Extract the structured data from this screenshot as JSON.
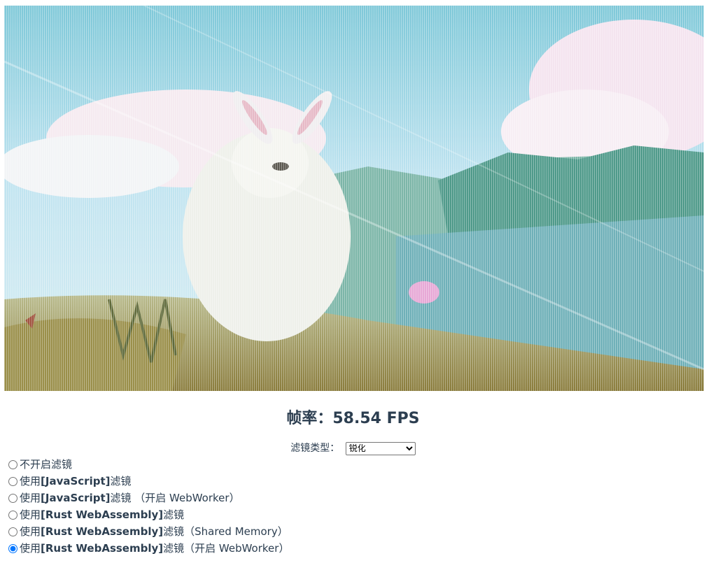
{
  "fps": {
    "label": "帧率：",
    "value": "58.54",
    "unit": "FPS"
  },
  "filter": {
    "label": "滤镜类型：",
    "selected": "锐化",
    "options": [
      "锐化"
    ]
  },
  "modes": [
    {
      "prefix": "不开启滤镜",
      "tech": "",
      "suffix": "",
      "checked": false
    },
    {
      "prefix": "使用 ",
      "tech": "[JavaScript]",
      "suffix": " 滤镜",
      "checked": false
    },
    {
      "prefix": "使用 ",
      "tech": "[JavaScript]",
      "suffix": " 滤镜 （开启 WebWorker）",
      "checked": false
    },
    {
      "prefix": "使用 ",
      "tech": "[Rust WebAssembly]",
      "suffix": " 滤镜",
      "checked": false
    },
    {
      "prefix": "使用 ",
      "tech": "[Rust WebAssembly]",
      "suffix": " 滤镜（Shared Memory）",
      "checked": false
    },
    {
      "prefix": "使用 ",
      "tech": "[Rust WebAssembly]",
      "suffix": " 滤镜（开启 WebWorker）",
      "checked": true
    }
  ],
  "colors": {
    "text": "#2c3e50",
    "radio_checked": "#1a73e8"
  }
}
